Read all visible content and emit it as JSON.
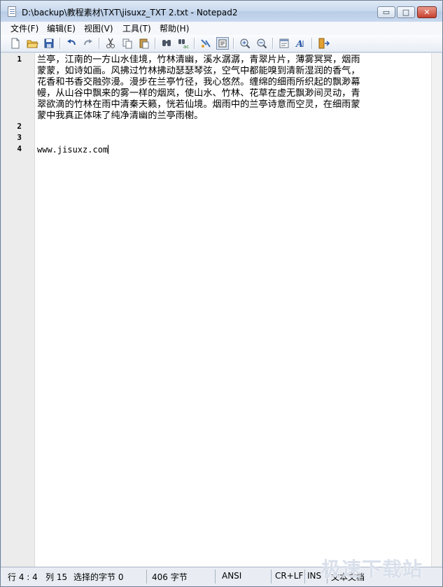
{
  "window": {
    "title": "D:\\backup\\教程素材\\TXT\\jisuxz_TXT 2.txt - Notepad2",
    "minimize_glyph": "▭",
    "maximize_glyph": "□",
    "close_glyph": "✕"
  },
  "menu": {
    "items": [
      "文件(F)",
      "编辑(E)",
      "视图(V)",
      "工具(T)",
      "帮助(H)"
    ]
  },
  "toolbar": {
    "icons": [
      "new-file-icon",
      "open-folder-icon",
      "save-icon",
      "undo-icon",
      "redo-icon",
      "cut-icon",
      "copy-icon",
      "paste-icon",
      "find-icon",
      "replace-icon",
      "wordwrap-icon",
      "view-whitespace-icon",
      "zoom-in-icon",
      "zoom-out-icon",
      "scheme-icon",
      "font-icon",
      "exit-icon"
    ]
  },
  "editor": {
    "line_numbers": [
      "1",
      "2",
      "3",
      "4"
    ],
    "wrapped_lines": [
      "兰亭，江南的一方山水佳境，竹林清幽，溪水潺潺，青翠片片，薄雾冥冥，烟雨",
      "蒙蒙，如诗如画。风拂过竹林拂动瑟瑟琴弦，空气中都能嗅到清新湿润的香气，",
      "花香和书香交融弥漫。漫步在兰亭竹径，我心悠然。缠绵的细雨所织起的飘渺幕",
      "幔，从山谷中飘来的雾一样的烟岚，使山水、竹林、花草在虚无飘渺间灵动，青",
      "翠欲滴的竹林在雨中清秦天籁，恍若仙境。烟雨中的兰亭诗意而空灵，在细雨蒙",
      "蒙中我真正体味了纯净清幽的兰亭雨榭。"
    ],
    "line4": "www.jisuxz.com"
  },
  "status": {
    "position": "行 4 : 4",
    "column": "列 15",
    "selected": "选择的字节 0",
    "bytes": "406 字节",
    "encoding": "ANSI",
    "eol": "CR+LF",
    "ins": "INS",
    "mode": "文本文档"
  },
  "watermark": "极速下载站",
  "colors": {
    "gutter": "#ececec",
    "titlebar": "#c9d9ee",
    "close_button": "#c6412f"
  }
}
